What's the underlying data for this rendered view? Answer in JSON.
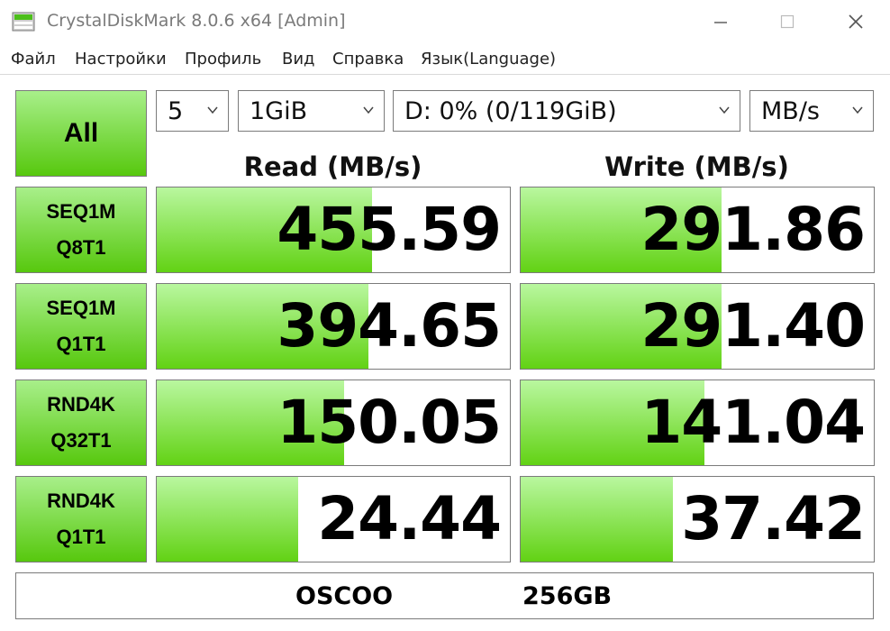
{
  "window": {
    "title": "CrystalDiskMark 8.0.6 x64 [Admin]"
  },
  "menu": [
    "Файл",
    "Настройки",
    "Профиль",
    "Вид",
    "Справка",
    "Язык(Language)"
  ],
  "controls": {
    "all_label": "All",
    "count": "5",
    "size": "1GiB",
    "drive": "D: 0% (0/119GiB)",
    "unit": "MB/s"
  },
  "headers": {
    "read": "Read (MB/s)",
    "write": "Write (MB/s)"
  },
  "tests": [
    {
      "line1": "SEQ1M",
      "line2": "Q8T1",
      "read": "455.59",
      "write": "291.86",
      "read_fill": 0.61,
      "write_fill": 0.57
    },
    {
      "line1": "SEQ1M",
      "line2": "Q1T1",
      "read": "394.65",
      "write": "291.40",
      "read_fill": 0.6,
      "write_fill": 0.57
    },
    {
      "line1": "RND4K",
      "line2": "Q32T1",
      "read": "150.05",
      "write": "141.04",
      "read_fill": 0.53,
      "write_fill": 0.52
    },
    {
      "line1": "RND4K",
      "line2": "Q1T1",
      "read": "24.44",
      "write": "37.42",
      "read_fill": 0.4,
      "write_fill": 0.43
    }
  ],
  "footer": {
    "model": "OSCOO",
    "capacity": "256GB"
  },
  "colors": {
    "green_top": "#a8ef8a",
    "green_bottom": "#57c80e"
  },
  "icons": {
    "app": "disk-icon",
    "minimize": "minimize-icon",
    "maximize": "maximize-icon",
    "close": "close-icon"
  }
}
